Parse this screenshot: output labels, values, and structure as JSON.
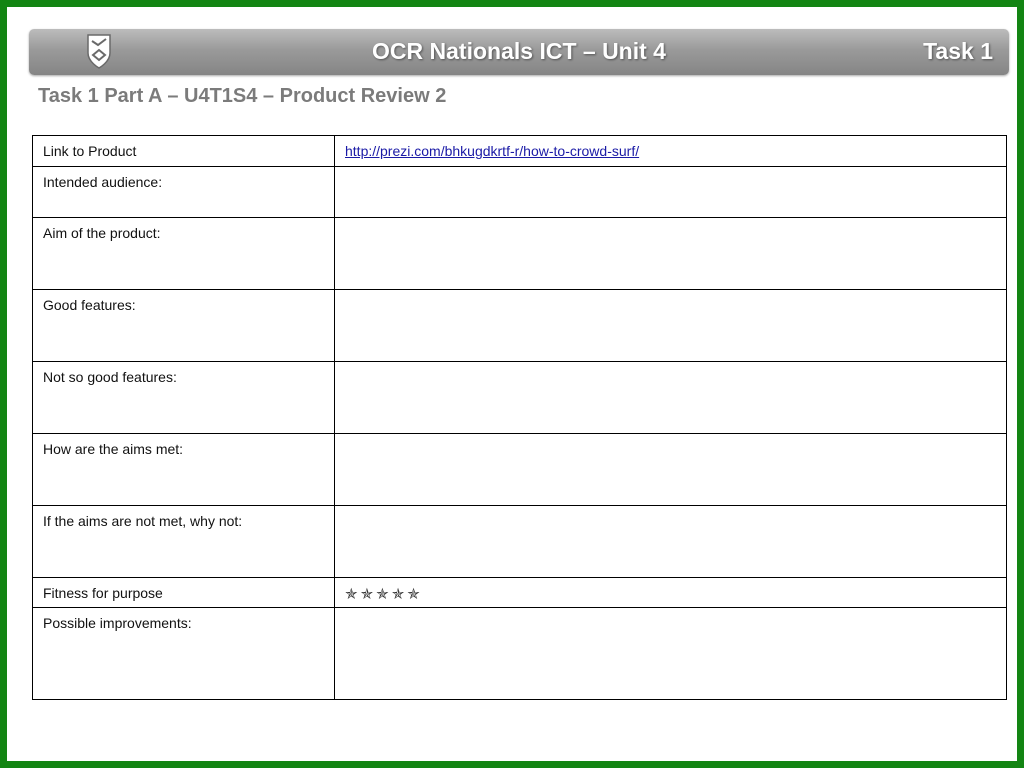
{
  "header": {
    "title": "OCR Nationals ICT – Unit 4",
    "task": "Task 1"
  },
  "subtitle": "Task 1 Part A – U4T1S4 – Product Review 2",
  "table": {
    "rows": [
      {
        "label": "Link to Product",
        "value": "http://prezi.com/bhkugdkrtf-r/how-to-crowd-surf/"
      },
      {
        "label": "Intended audience:",
        "value": ""
      },
      {
        "label": "Aim of the product:",
        "value": ""
      },
      {
        "label": "Good features:",
        "value": ""
      },
      {
        "label": "Not so good features:",
        "value": ""
      },
      {
        "label": "How are the aims met:",
        "value": ""
      },
      {
        "label": "If the aims are not met, why not:",
        "value": ""
      },
      {
        "label": "Fitness for purpose",
        "value": "✯✯✯✯✯"
      },
      {
        "label": "Possible improvements:",
        "value": ""
      }
    ]
  },
  "colors": {
    "border_green": "#138513",
    "header_gray": "#9a9a9a",
    "link_blue": "#1a1aa6"
  },
  "icons": {
    "logo": "school-crest-icon",
    "rating": "star-icon"
  }
}
